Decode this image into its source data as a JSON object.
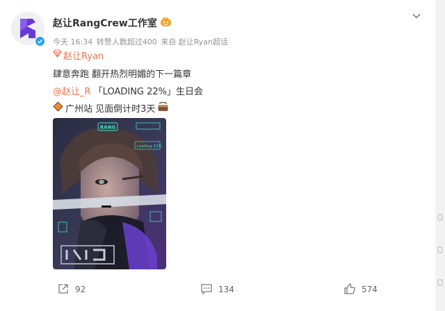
{
  "post": {
    "author": "赵让RangCrew工作室",
    "meta": {
      "time": "今天 16:34",
      "reposts_note": "转赞人数超过400",
      "source": "来自 赵让Ryan超话"
    },
    "topic": "赵让Ryan",
    "lines": {
      "line1": "肆意奔跑 翻开热烈明媚的下一篇章",
      "mention": "@赵让_R",
      "event": " 「LOADING 22%」生日会",
      "location": "广州站 见面倒计时3天"
    },
    "poster": {
      "brand_text": "RANG",
      "loading_text": "Loading 22%"
    }
  },
  "actions": {
    "repost_count": "92",
    "comment_count": "134",
    "like_count": "574"
  },
  "colors": {
    "link": "#eb7350",
    "verified": "#2a9df4",
    "avatar_logo": "#6a38d8"
  }
}
